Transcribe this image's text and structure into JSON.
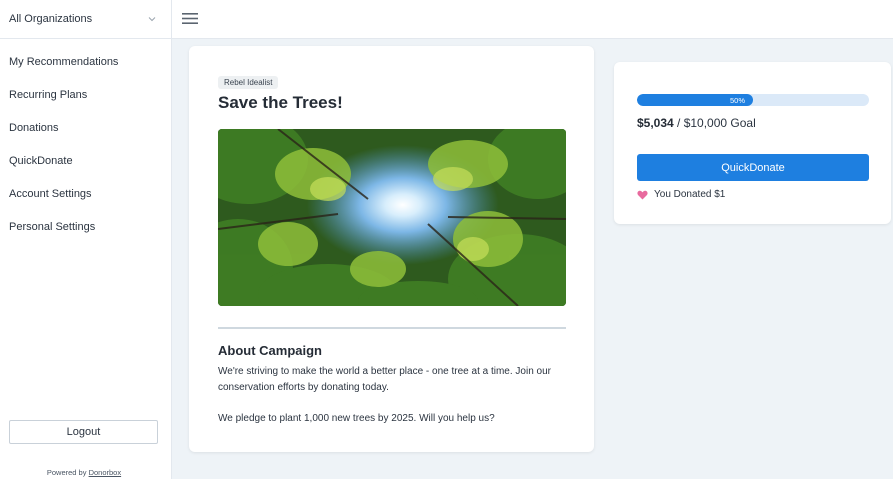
{
  "sidebar": {
    "org_select": "All Organizations",
    "items": [
      {
        "label": "My Recommendations"
      },
      {
        "label": "Recurring Plans"
      },
      {
        "label": "Donations"
      },
      {
        "label": "QuickDonate"
      },
      {
        "label": "Account Settings"
      },
      {
        "label": "Personal Settings"
      }
    ],
    "logout_label": "Logout",
    "powered_prefix": "Powered by ",
    "powered_link": "Donorbox"
  },
  "campaign": {
    "tag": "Rebel Idealist",
    "title": "Save the Trees!",
    "about_heading": "About Campaign",
    "about_p1": "We're striving to make the world a better place - one tree at a time. Join our conservation efforts by donating today.",
    "about_p2": "We pledge to plant 1,000 new trees by 2025. Will you help us?"
  },
  "donation": {
    "progress_percent": 50,
    "progress_label": "50%",
    "raised": "$5,034",
    "goal": " / $10,000 Goal",
    "quickdonate_label": "QuickDonate",
    "donated_text": "You Donated $1"
  },
  "colors": {
    "accent": "#1e7fe0",
    "progress_track": "#dbe9f8",
    "heart": "#e86a9e",
    "background": "#eef3f7"
  },
  "icons": {
    "org_chevron": "chevron-down-icon",
    "menu": "hamburger-menu-icon",
    "heart": "heart-icon"
  }
}
